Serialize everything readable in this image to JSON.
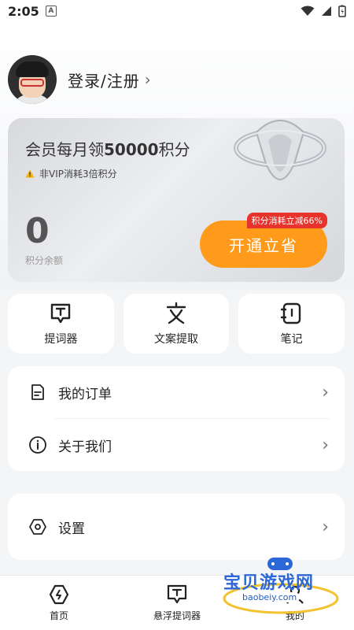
{
  "status_bar": {
    "time": "2:05",
    "app_icon": "A"
  },
  "profile": {
    "login_label": "登录/注册",
    "chevron": "›"
  },
  "vip_card": {
    "title_prefix": "会员每月领",
    "title_amount": "50000",
    "title_suffix": "积分",
    "note": "非VIP消耗3倍积分",
    "points_value": "0",
    "points_label": "积分余额",
    "promo_badge": "积分消耗立减66%",
    "open_button": "开通立省"
  },
  "tools": [
    {
      "label": "提词器",
      "icon": "teleprompter-icon"
    },
    {
      "label": "文案提取",
      "icon": "text-extract-icon"
    },
    {
      "label": "笔记",
      "icon": "notes-icon"
    }
  ],
  "menu_group_1": [
    {
      "label": "我的订单",
      "icon": "order-icon"
    },
    {
      "label": "关于我们",
      "icon": "info-icon"
    }
  ],
  "menu_group_2": [
    {
      "label": "设置",
      "icon": "settings-icon"
    }
  ],
  "bottom_nav": [
    {
      "label": "首页",
      "icon": "home-icon"
    },
    {
      "label": "悬浮提词器",
      "icon": "floating-teleprompter-icon"
    },
    {
      "label": "我的",
      "icon": "profile-icon"
    }
  ],
  "watermark": {
    "text": "宝贝游戏网",
    "url": "baobeiy.com"
  },
  "colors": {
    "accent": "#ff9a1a",
    "badge": "#e8322c"
  }
}
